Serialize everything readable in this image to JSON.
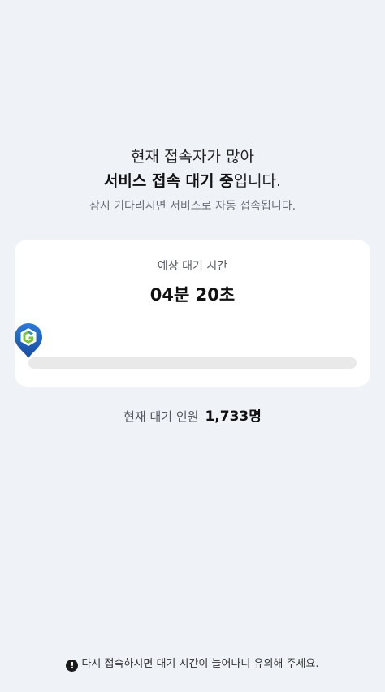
{
  "headline": {
    "line1": "현재 접속자가 많아",
    "line2_bold": "서비스 접속 대기 중",
    "line2_rest": "입니다.",
    "subtitle": "잠시 기다리시면 서비스로 자동 접속됩니다."
  },
  "wait_card": {
    "label": "예상 대기 시간",
    "time": "04분 20초",
    "progress_percent": 0,
    "track_color": "#e9e9ea",
    "marker_icon": "location-pin-logo-icon"
  },
  "queue": {
    "label": "현재 대기 인원",
    "count": "1,733명"
  },
  "notice": {
    "icon": "exclamation-circle-icon",
    "text": "다시 접속하시면 대기 시간이 늘어나니 유의해 주세요."
  },
  "colors": {
    "background": "#eff3f8",
    "card": "#ffffff",
    "marker_blue": "#1b5fbf",
    "marker_green": "#7cc242"
  }
}
